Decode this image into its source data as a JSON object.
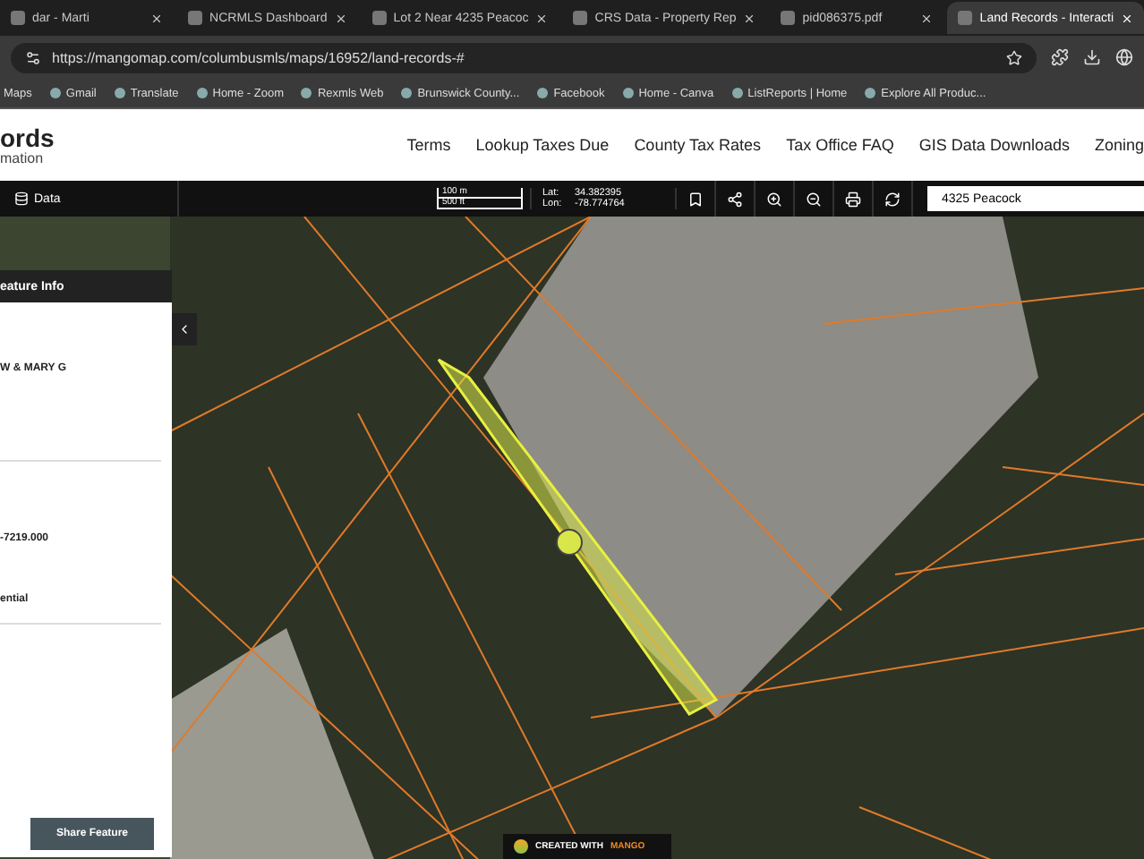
{
  "browser": {
    "tabs": [
      {
        "label": "dar - Marti",
        "selected": false
      },
      {
        "label": "NCRMLS Dashboard",
        "selected": false
      },
      {
        "label": "Lot 2 Near 4235 Peacoc",
        "selected": false
      },
      {
        "label": "CRS Data - Property Rep",
        "selected": false
      },
      {
        "label": "pid086375.pdf",
        "selected": false
      },
      {
        "label": "Land Records - Interacti",
        "selected": true
      }
    ],
    "url": "https://mangomap.com/columbusmls/maps/16952/land-records-#",
    "bookmarks": [
      "Maps",
      "Gmail",
      "Translate",
      "Home - Zoom",
      "Rexmls Web",
      "Brunswick County...",
      "Facebook",
      "Home - Canva",
      "ListReports | Home",
      "Explore All Produc..."
    ]
  },
  "site": {
    "title": "ords",
    "subtitle": "mation",
    "nav": [
      "Terms",
      "Lookup Taxes Due",
      "County Tax Rates",
      "Tax Office FAQ",
      "GIS Data Downloads",
      "Zoning"
    ]
  },
  "toolbar": {
    "data_button": "Data",
    "scale": [
      "100 m",
      "500 ft"
    ],
    "lat_label": "Lat:",
    "lat": "34.382395",
    "lon_label": "Lon:",
    "lon": "-78.774764",
    "search_value": "4325 Peacock"
  },
  "panel": {
    "title": "eature Info",
    "fields": [
      "W & MARY G",
      "-7219.000",
      "ential"
    ],
    "share_button": "Share Feature"
  },
  "attribution": {
    "text": "CREATED WITH",
    "brand": "MANGO"
  }
}
